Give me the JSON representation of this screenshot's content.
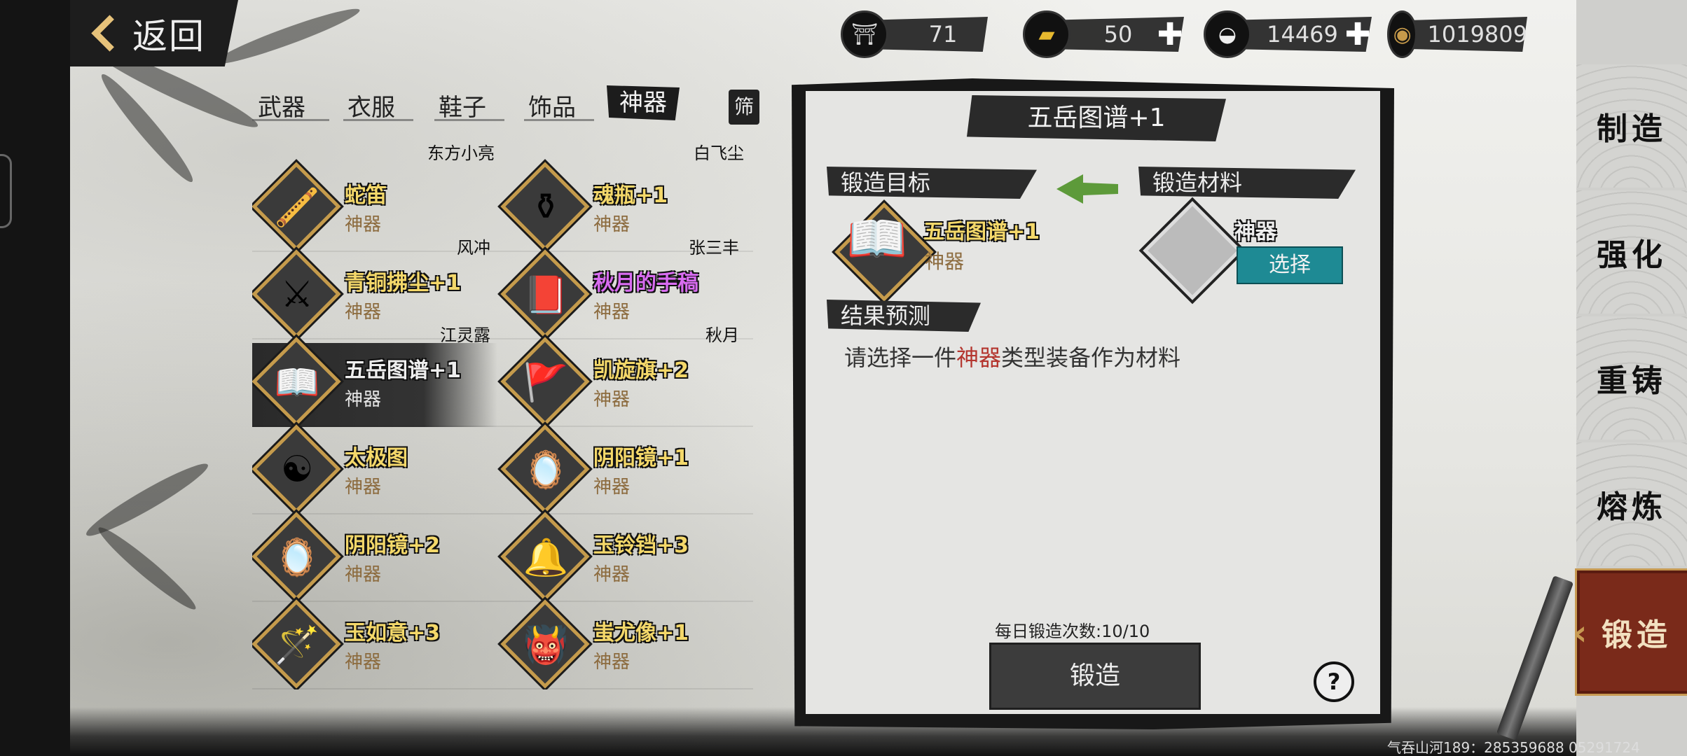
{
  "topbar": {
    "back_label": "返回",
    "currencies": [
      {
        "icon": "cauldron-icon",
        "value": "71",
        "has_plus": false
      },
      {
        "icon": "gold-bar-icon",
        "value": "50",
        "has_plus": true
      },
      {
        "icon": "silver-ingot-icon",
        "value": "14469",
        "has_plus": true
      },
      {
        "icon": "copper-coin-icon",
        "value": "1019809",
        "has_plus": false
      }
    ]
  },
  "tabs": [
    "武器",
    "衣服",
    "鞋子",
    "饰品",
    "神器"
  ],
  "active_tab": "神器",
  "filter_label": "筛",
  "items": {
    "top_owners": [
      "东方小亮",
      "白飞尘"
    ],
    "list": [
      {
        "name": "蛇笛",
        "type": "神器",
        "owner": "风冲",
        "icon": "snake-flute-icon",
        "glyph": "🪈",
        "color": "gold"
      },
      {
        "name": "魂瓶+1",
        "type": "神器",
        "owner": "张三丰",
        "icon": "soul-bottle-icon",
        "glyph": "⚱",
        "color": "gold"
      },
      {
        "name": "青铜拂尘+1",
        "type": "神器",
        "owner": "江灵露",
        "icon": "bronze-whisk-icon",
        "glyph": "⚔",
        "color": "gold"
      },
      {
        "name": "秋月的手稿",
        "type": "神器",
        "owner": "秋月",
        "icon": "manuscript-icon",
        "glyph": "📕",
        "color": "purple"
      },
      {
        "name": "五岳图谱+1",
        "type": "神器",
        "owner": "",
        "icon": "open-book-icon",
        "glyph": "📖",
        "color": "white",
        "selected": true
      },
      {
        "name": "凯旋旗+2",
        "type": "神器",
        "owner": "",
        "icon": "triumph-flag-icon",
        "glyph": "🚩",
        "color": "gold"
      },
      {
        "name": "太极图",
        "type": "神器",
        "owner": "",
        "icon": "taiji-map-icon",
        "glyph": "☯",
        "color": "gold"
      },
      {
        "name": "阴阳镜+1",
        "type": "神器",
        "owner": "",
        "icon": "yinyang-mirror-icon",
        "glyph": "🪞",
        "color": "gold"
      },
      {
        "name": "阴阳镜+2",
        "type": "神器",
        "owner": "",
        "icon": "yinyang-mirror-icon",
        "glyph": "🪞",
        "color": "gold"
      },
      {
        "name": "玉铃铛+3",
        "type": "神器",
        "owner": "",
        "icon": "jade-bell-icon",
        "glyph": "🔔",
        "color": "gold"
      },
      {
        "name": "玉如意+3",
        "type": "神器",
        "owner": "",
        "icon": "jade-ruyi-icon",
        "glyph": "🪄",
        "color": "gold"
      },
      {
        "name": "蚩尤像+1",
        "type": "神器",
        "owner": "",
        "icon": "chiyou-statue-icon",
        "glyph": "👹",
        "color": "gold"
      }
    ]
  },
  "forge": {
    "title": "五岳图谱+1",
    "target_label": "锻造目标",
    "material_label": "锻造材料",
    "target_name": "五岳图谱+1",
    "target_type": "神器",
    "material_name": "神器",
    "select_label": "选择",
    "result_label": "结果预测",
    "hint_prefix": "请选择一件",
    "hint_keyword": "神器",
    "hint_suffix": "类型装备作为材料",
    "daily_label": "每日锻造次数:10/10",
    "forge_button": "锻造",
    "help_label": "?"
  },
  "side_nav": [
    "制造",
    "强化",
    "重铸",
    "熔炼",
    "锻造"
  ],
  "side_nav_active": "锻造",
  "watermark": "气吞山河189：285359688  05291724",
  "colors": {
    "accent_gold": "#f4d86a",
    "select_teal": "#1e8a94",
    "active_nav": "#7a2a1a",
    "keyword_red": "#b4362f"
  }
}
